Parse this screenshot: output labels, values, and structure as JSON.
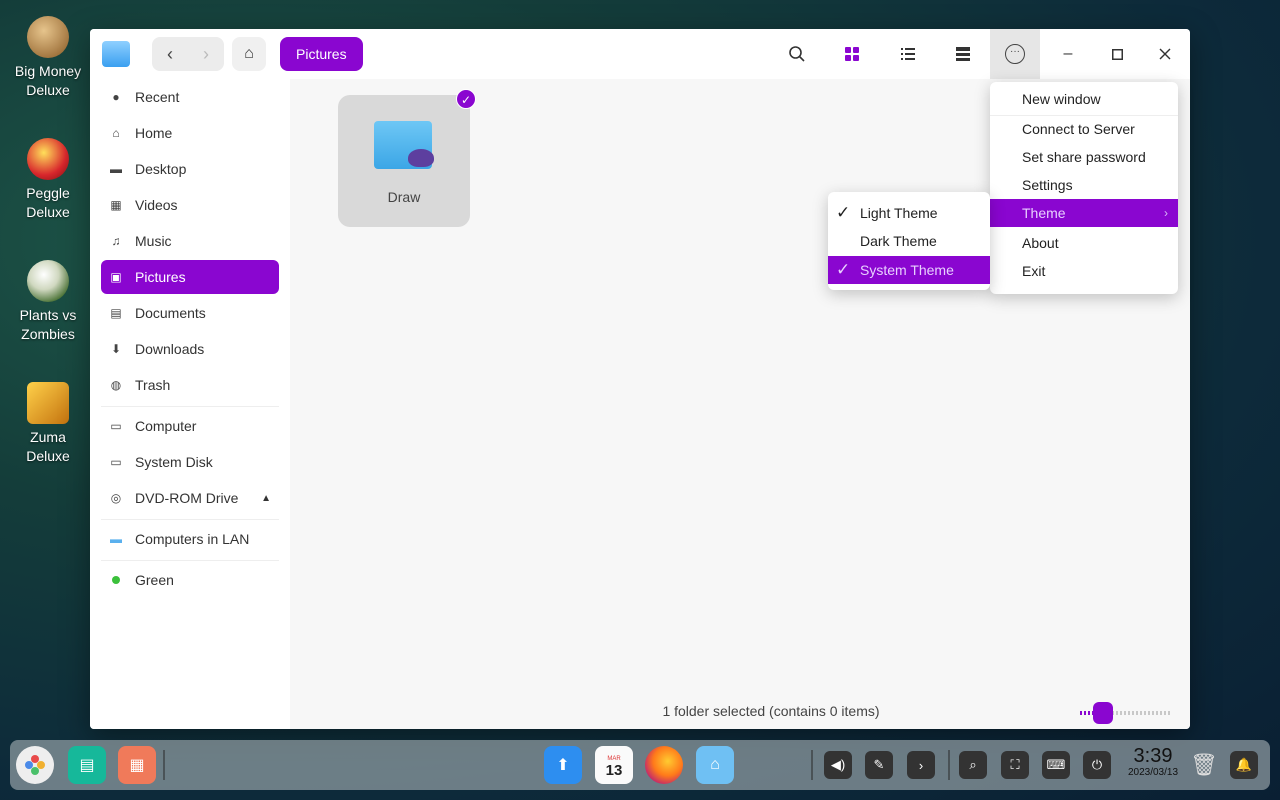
{
  "desktop": {
    "icons": [
      {
        "label": "Big Money Deluxe"
      },
      {
        "label": "Peggle Deluxe"
      },
      {
        "label": "Plants vs Zombies"
      },
      {
        "label": "Zuma Deluxe"
      }
    ]
  },
  "window": {
    "breadcrumb": "Pictures",
    "status": "1 folder selected (contains 0 items)",
    "zoom_level": 0.25
  },
  "sidebar": {
    "items": [
      {
        "label": "Recent",
        "icon": "clock-icon"
      },
      {
        "label": "Home",
        "icon": "home-icon"
      },
      {
        "label": "Desktop",
        "icon": "desktop-icon"
      },
      {
        "label": "Videos",
        "icon": "video-icon"
      },
      {
        "label": "Music",
        "icon": "music-icon"
      },
      {
        "label": "Pictures",
        "icon": "pictures-icon",
        "selected": true
      },
      {
        "label": "Documents",
        "icon": "document-icon"
      },
      {
        "label": "Downloads",
        "icon": "download-icon"
      },
      {
        "label": "Trash",
        "icon": "trash-icon"
      },
      {
        "label": "Computer",
        "icon": "computer-icon"
      },
      {
        "label": "System Disk",
        "icon": "disk-icon"
      },
      {
        "label": "DVD-ROM Drive",
        "icon": "dvd-icon"
      },
      {
        "label": "Computers in LAN",
        "icon": "network-icon"
      },
      {
        "label": "Green",
        "icon": "green-tag-icon"
      }
    ]
  },
  "files": [
    {
      "name": "Draw",
      "selected": true
    }
  ],
  "main_menu": {
    "items": [
      {
        "label": "New window"
      },
      {
        "label": "Connect to Server"
      },
      {
        "label": "Set share password"
      },
      {
        "label": "Settings"
      },
      {
        "label": "Theme"
      },
      {
        "label": "About"
      },
      {
        "label": "Exit"
      }
    ]
  },
  "theme_menu": {
    "items": [
      {
        "label": "Light Theme",
        "checked": true
      },
      {
        "label": "Dark Theme",
        "checked": false
      },
      {
        "label": "System Theme",
        "checked": true
      }
    ]
  },
  "dock": {
    "calendar_month": "MAR",
    "calendar_day": "13"
  },
  "clock": {
    "time": "3:39",
    "date": "2023/03/13"
  },
  "colors": {
    "accent": "#8a06d0"
  }
}
